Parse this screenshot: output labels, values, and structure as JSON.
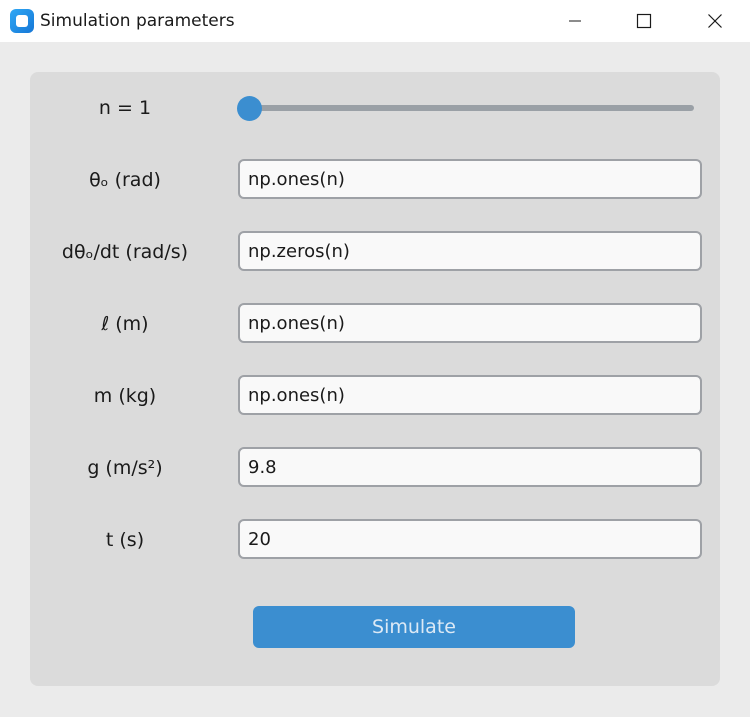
{
  "window": {
    "title": "Simulation parameters",
    "icon": "app-icon",
    "controls": [
      "minimize-icon",
      "maximize-icon",
      "close-icon"
    ]
  },
  "slider": {
    "label": "n = 1",
    "value": 1,
    "fraction": 0.0,
    "color": "#3b8ed0"
  },
  "fields": [
    {
      "label": "θₒ (rad)",
      "value": "np.ones(n)"
    },
    {
      "label": "dθₒ/dt (rad/s)",
      "value": "np.zeros(n)"
    },
    {
      "label": "ℓ (m)",
      "value": "np.ones(n)"
    },
    {
      "label": "m (kg)",
      "value": "np.ones(n)"
    },
    {
      "label": "g (m/s²)",
      "value": "9.8"
    },
    {
      "label": "t (s)",
      "value": "20"
    }
  ],
  "simulate_button": {
    "label": "Simulate",
    "color": "#3b8ed0"
  }
}
